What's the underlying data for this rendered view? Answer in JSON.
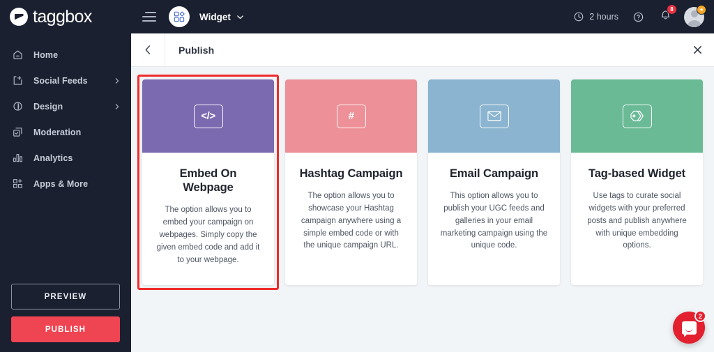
{
  "brand": {
    "name": "taggbox",
    "logo_icon": "taggbox-logo-icon"
  },
  "sidebar": {
    "items": [
      {
        "label": "Home",
        "icon": "home-icon",
        "has_chevron": false
      },
      {
        "label": "Social Feeds",
        "icon": "feed-add-icon",
        "has_chevron": true
      },
      {
        "label": "Design",
        "icon": "droplet-icon",
        "has_chevron": true
      },
      {
        "label": "Moderation",
        "icon": "moderation-check-icon",
        "has_chevron": false
      },
      {
        "label": "Analytics",
        "icon": "bar-chart-icon",
        "has_chevron": false
      },
      {
        "label": "Apps & More",
        "icon": "apps-grid-add-icon",
        "has_chevron": false
      }
    ],
    "preview_label": "PREVIEW",
    "publish_label": "PUBLISH",
    "publish_color": "#ef4452"
  },
  "topbar": {
    "menu_icon": "hamburger-menu-icon",
    "widget_icon": "widget-shapes-icon",
    "widget_name": "Widget",
    "widget_chevron_icon": "chevron-down-icon",
    "clock_icon": "clock-icon",
    "time_remaining": "2 hours",
    "help_icon": "help-circle-icon",
    "bell_icon": "bell-icon",
    "notification_count": "8",
    "notification_badge_color": "#e8313f",
    "avatar_icon": "user-avatar",
    "avatar_badge_icon": "star-badge-icon",
    "avatar_badge_color": "#f6a623"
  },
  "page_header": {
    "back_icon": "chevron-left-icon",
    "title": "Publish",
    "close_icon": "close-icon"
  },
  "cards": [
    {
      "id": "embed-on-webpage",
      "hero_color": "#7b6ab0",
      "icon": "code-brackets-icon",
      "icon_glyph": "</>",
      "title": "Embed On Webpage",
      "description": "The option allows you to embed your campaign on webpages. Simply copy the given embed code and add it to your webpage.",
      "selected": true,
      "selection_color": "#ef2b2b"
    },
    {
      "id": "hashtag-campaign",
      "hero_color": "#ed9097",
      "icon": "hashtag-icon",
      "icon_glyph": "#",
      "title": "Hashtag Campaign",
      "description": "The option allows you to showcase your Hashtag campaign anywhere using a simple embed code or with the unique campaign URL.",
      "selected": false
    },
    {
      "id": "email-campaign",
      "hero_color": "#8ab4cf",
      "icon": "envelope-icon",
      "icon_glyph": "✉",
      "title": "Email Campaign",
      "description": "This option allows you to publish your UGC feeds and galleries in your email marketing campaign using the unique code.",
      "selected": false
    },
    {
      "id": "tag-based-widget",
      "hero_color": "#6aba96",
      "icon": "price-tag-icon",
      "icon_glyph": "⚑",
      "title": "Tag-based Widget",
      "description": "Use tags to curate social widgets with your preferred posts and publish anywhere with unique embedding options.",
      "selected": false
    }
  ],
  "chat": {
    "icon": "chat-bubble-icon",
    "unread_count": "2",
    "color": "#e3202f"
  }
}
